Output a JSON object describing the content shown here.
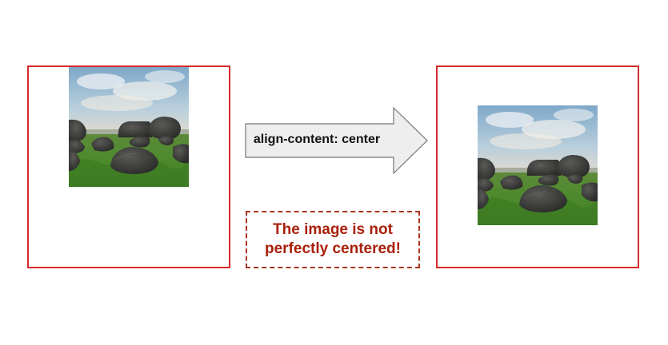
{
  "arrow": {
    "label": "align-content: center"
  },
  "note": {
    "text": "The image is not perfectly centered!"
  },
  "colors": {
    "frame_border": "#d42a2a",
    "note_border": "#a8361e",
    "note_text": "#a8200b",
    "arrow_fill": "#eeeeee",
    "arrow_stroke": "#777777"
  },
  "images": {
    "left": {
      "icon": "landscape-rocks-photo"
    },
    "right": {
      "icon": "landscape-rocks-photo"
    }
  }
}
